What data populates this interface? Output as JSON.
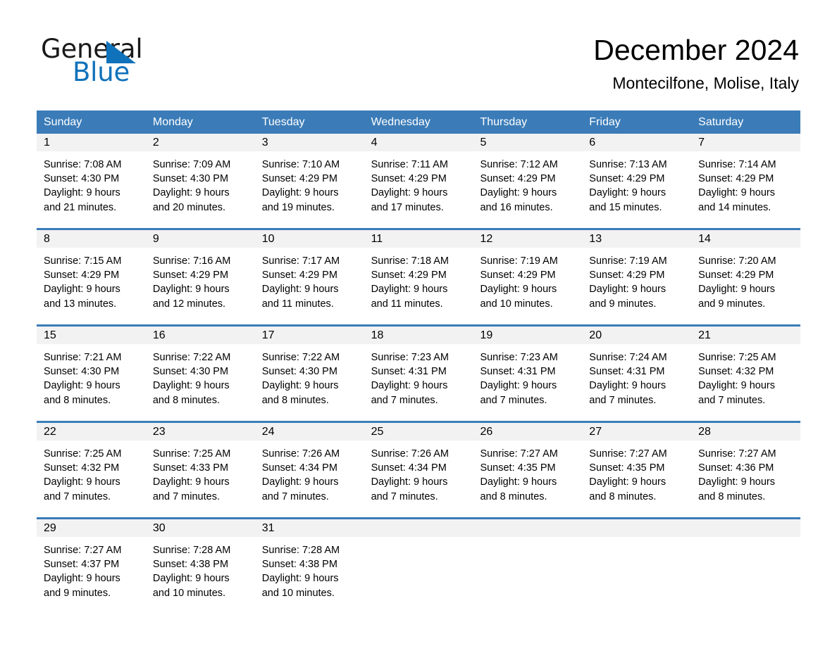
{
  "brand": {
    "name_part1": "General",
    "name_part2": "Blue",
    "triangle_color": "#1072bb",
    "text_color": "#1a1a1a"
  },
  "header": {
    "title": "December 2024",
    "subtitle": "Montecilfone, Molise, Italy"
  },
  "theme": {
    "header_blue": "#3b7cb8",
    "row_divider_blue": "#3b7cb8",
    "day_band_gray": "#f2f2f2",
    "background": "#ffffff"
  },
  "weekdays": [
    "Sunday",
    "Monday",
    "Tuesday",
    "Wednesday",
    "Thursday",
    "Friday",
    "Saturday"
  ],
  "weeks": [
    {
      "days": [
        {
          "date": "1",
          "sunrise": "Sunrise: 7:08 AM",
          "sunset": "Sunset: 4:30 PM",
          "daylight_line1": "Daylight: 9 hours",
          "daylight_line2": "and 21 minutes."
        },
        {
          "date": "2",
          "sunrise": "Sunrise: 7:09 AM",
          "sunset": "Sunset: 4:30 PM",
          "daylight_line1": "Daylight: 9 hours",
          "daylight_line2": "and 20 minutes."
        },
        {
          "date": "3",
          "sunrise": "Sunrise: 7:10 AM",
          "sunset": "Sunset: 4:29 PM",
          "daylight_line1": "Daylight: 9 hours",
          "daylight_line2": "and 19 minutes."
        },
        {
          "date": "4",
          "sunrise": "Sunrise: 7:11 AM",
          "sunset": "Sunset: 4:29 PM",
          "daylight_line1": "Daylight: 9 hours",
          "daylight_line2": "and 17 minutes."
        },
        {
          "date": "5",
          "sunrise": "Sunrise: 7:12 AM",
          "sunset": "Sunset: 4:29 PM",
          "daylight_line1": "Daylight: 9 hours",
          "daylight_line2": "and 16 minutes."
        },
        {
          "date": "6",
          "sunrise": "Sunrise: 7:13 AM",
          "sunset": "Sunset: 4:29 PM",
          "daylight_line1": "Daylight: 9 hours",
          "daylight_line2": "and 15 minutes."
        },
        {
          "date": "7",
          "sunrise": "Sunrise: 7:14 AM",
          "sunset": "Sunset: 4:29 PM",
          "daylight_line1": "Daylight: 9 hours",
          "daylight_line2": "and 14 minutes."
        }
      ]
    },
    {
      "days": [
        {
          "date": "8",
          "sunrise": "Sunrise: 7:15 AM",
          "sunset": "Sunset: 4:29 PM",
          "daylight_line1": "Daylight: 9 hours",
          "daylight_line2": "and 13 minutes."
        },
        {
          "date": "9",
          "sunrise": "Sunrise: 7:16 AM",
          "sunset": "Sunset: 4:29 PM",
          "daylight_line1": "Daylight: 9 hours",
          "daylight_line2": "and 12 minutes."
        },
        {
          "date": "10",
          "sunrise": "Sunrise: 7:17 AM",
          "sunset": "Sunset: 4:29 PM",
          "daylight_line1": "Daylight: 9 hours",
          "daylight_line2": "and 11 minutes."
        },
        {
          "date": "11",
          "sunrise": "Sunrise: 7:18 AM",
          "sunset": "Sunset: 4:29 PM",
          "daylight_line1": "Daylight: 9 hours",
          "daylight_line2": "and 11 minutes."
        },
        {
          "date": "12",
          "sunrise": "Sunrise: 7:19 AM",
          "sunset": "Sunset: 4:29 PM",
          "daylight_line1": "Daylight: 9 hours",
          "daylight_line2": "and 10 minutes."
        },
        {
          "date": "13",
          "sunrise": "Sunrise: 7:19 AM",
          "sunset": "Sunset: 4:29 PM",
          "daylight_line1": "Daylight: 9 hours",
          "daylight_line2": "and 9 minutes."
        },
        {
          "date": "14",
          "sunrise": "Sunrise: 7:20 AM",
          "sunset": "Sunset: 4:29 PM",
          "daylight_line1": "Daylight: 9 hours",
          "daylight_line2": "and 9 minutes."
        }
      ]
    },
    {
      "days": [
        {
          "date": "15",
          "sunrise": "Sunrise: 7:21 AM",
          "sunset": "Sunset: 4:30 PM",
          "daylight_line1": "Daylight: 9 hours",
          "daylight_line2": "and 8 minutes."
        },
        {
          "date": "16",
          "sunrise": "Sunrise: 7:22 AM",
          "sunset": "Sunset: 4:30 PM",
          "daylight_line1": "Daylight: 9 hours",
          "daylight_line2": "and 8 minutes."
        },
        {
          "date": "17",
          "sunrise": "Sunrise: 7:22 AM",
          "sunset": "Sunset: 4:30 PM",
          "daylight_line1": "Daylight: 9 hours",
          "daylight_line2": "and 8 minutes."
        },
        {
          "date": "18",
          "sunrise": "Sunrise: 7:23 AM",
          "sunset": "Sunset: 4:31 PM",
          "daylight_line1": "Daylight: 9 hours",
          "daylight_line2": "and 7 minutes."
        },
        {
          "date": "19",
          "sunrise": "Sunrise: 7:23 AM",
          "sunset": "Sunset: 4:31 PM",
          "daylight_line1": "Daylight: 9 hours",
          "daylight_line2": "and 7 minutes."
        },
        {
          "date": "20",
          "sunrise": "Sunrise: 7:24 AM",
          "sunset": "Sunset: 4:31 PM",
          "daylight_line1": "Daylight: 9 hours",
          "daylight_line2": "and 7 minutes."
        },
        {
          "date": "21",
          "sunrise": "Sunrise: 7:25 AM",
          "sunset": "Sunset: 4:32 PM",
          "daylight_line1": "Daylight: 9 hours",
          "daylight_line2": "and 7 minutes."
        }
      ]
    },
    {
      "days": [
        {
          "date": "22",
          "sunrise": "Sunrise: 7:25 AM",
          "sunset": "Sunset: 4:32 PM",
          "daylight_line1": "Daylight: 9 hours",
          "daylight_line2": "and 7 minutes."
        },
        {
          "date": "23",
          "sunrise": "Sunrise: 7:25 AM",
          "sunset": "Sunset: 4:33 PM",
          "daylight_line1": "Daylight: 9 hours",
          "daylight_line2": "and 7 minutes."
        },
        {
          "date": "24",
          "sunrise": "Sunrise: 7:26 AM",
          "sunset": "Sunset: 4:34 PM",
          "daylight_line1": "Daylight: 9 hours",
          "daylight_line2": "and 7 minutes."
        },
        {
          "date": "25",
          "sunrise": "Sunrise: 7:26 AM",
          "sunset": "Sunset: 4:34 PM",
          "daylight_line1": "Daylight: 9 hours",
          "daylight_line2": "and 7 minutes."
        },
        {
          "date": "26",
          "sunrise": "Sunrise: 7:27 AM",
          "sunset": "Sunset: 4:35 PM",
          "daylight_line1": "Daylight: 9 hours",
          "daylight_line2": "and 8 minutes."
        },
        {
          "date": "27",
          "sunrise": "Sunrise: 7:27 AM",
          "sunset": "Sunset: 4:35 PM",
          "daylight_line1": "Daylight: 9 hours",
          "daylight_line2": "and 8 minutes."
        },
        {
          "date": "28",
          "sunrise": "Sunrise: 7:27 AM",
          "sunset": "Sunset: 4:36 PM",
          "daylight_line1": "Daylight: 9 hours",
          "daylight_line2": "and 8 minutes."
        }
      ]
    },
    {
      "days": [
        {
          "date": "29",
          "sunrise": "Sunrise: 7:27 AM",
          "sunset": "Sunset: 4:37 PM",
          "daylight_line1": "Daylight: 9 hours",
          "daylight_line2": "and 9 minutes."
        },
        {
          "date": "30",
          "sunrise": "Sunrise: 7:28 AM",
          "sunset": "Sunset: 4:38 PM",
          "daylight_line1": "Daylight: 9 hours",
          "daylight_line2": "and 10 minutes."
        },
        {
          "date": "31",
          "sunrise": "Sunrise: 7:28 AM",
          "sunset": "Sunset: 4:38 PM",
          "daylight_line1": "Daylight: 9 hours",
          "daylight_line2": "and 10 minutes."
        },
        {
          "date": "",
          "sunrise": "",
          "sunset": "",
          "daylight_line1": "",
          "daylight_line2": ""
        },
        {
          "date": "",
          "sunrise": "",
          "sunset": "",
          "daylight_line1": "",
          "daylight_line2": ""
        },
        {
          "date": "",
          "sunrise": "",
          "sunset": "",
          "daylight_line1": "",
          "daylight_line2": ""
        },
        {
          "date": "",
          "sunrise": "",
          "sunset": "",
          "daylight_line1": "",
          "daylight_line2": ""
        }
      ]
    }
  ]
}
